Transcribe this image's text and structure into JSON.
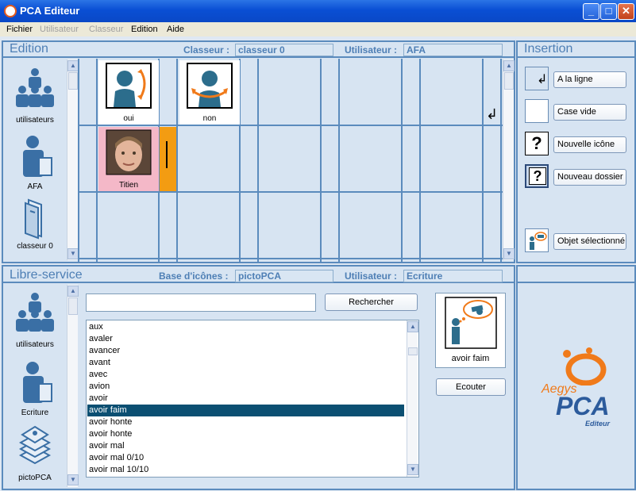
{
  "window": {
    "title": "PCA Editeur",
    "minimize": "_",
    "maximize": "□",
    "close": "✕"
  },
  "menu": [
    {
      "label": "Fichier",
      "enabled": true
    },
    {
      "label": "Utilisateur",
      "enabled": false
    },
    {
      "label": "Classeur",
      "enabled": false
    },
    {
      "label": "Edition",
      "enabled": true
    },
    {
      "label": "Aide",
      "enabled": true
    }
  ],
  "edition": {
    "title": "Edition",
    "classeur_label": "Classeur  :",
    "classeur_value": "classeur 0",
    "utilisateur_label": "Utilisateur :",
    "utilisateur_value": "AFA",
    "sidebar": [
      {
        "label": "utilisateurs",
        "icon": "users-group-icon"
      },
      {
        "label": "AFA",
        "icon": "user-folder-icon"
      },
      {
        "label": "classeur 0",
        "icon": "binder-icon"
      }
    ],
    "cells": [
      {
        "label": "oui",
        "icon": "nod-yes-pictogram"
      },
      {
        "label": "non",
        "icon": "shake-no-pictogram"
      },
      {
        "label": "Titien",
        "icon": "photo-titien"
      }
    ],
    "newline_symbol": "↲"
  },
  "insertion": {
    "title": "Insertion",
    "buttons": [
      {
        "label": "A la ligne",
        "icon": "newline-icon"
      },
      {
        "label": "Case vide",
        "icon": "empty-cell-icon"
      },
      {
        "label": "Nouvelle icône",
        "icon": "question-mark-icon"
      },
      {
        "label": "Nouveau dossier",
        "icon": "question-folder-icon"
      },
      {
        "label": "Objet sélectionné",
        "icon": "selected-object-icon"
      }
    ]
  },
  "libre": {
    "title": "Libre-service",
    "base_label": "Base d'icônes  :",
    "base_value": "pictoPCA",
    "utilisateur_label": "Utilisateur :",
    "utilisateur_value": "Ecriture",
    "sidebar": [
      {
        "label": "utilisateurs",
        "icon": "users-group-icon"
      },
      {
        "label": "Ecriture",
        "icon": "user-folder-icon"
      },
      {
        "label": "pictoPCA",
        "icon": "picto-stack-icon"
      }
    ],
    "search_value": "",
    "search_button": "Rechercher",
    "list": [
      "aux",
      "avaler",
      "avancer",
      "avant",
      "avec",
      "avion",
      "avoir",
      "avoir faim",
      "avoir honte",
      "avoir honte",
      "avoir mal",
      "avoir mal 0/10",
      "avoir mal 10/10"
    ],
    "selected": "avoir faim",
    "preview_label": "avoir faim",
    "listen_button": "Ecouter"
  },
  "brand": {
    "aegys": "Aegys",
    "pca": "PCA",
    "editeur": "Editeur"
  },
  "colors": {
    "accent": "#4e7fb5",
    "border": "#5b8bbd",
    "selection": "#0b4f72",
    "titien_cell": "#f4b8c8",
    "cursor_cell": "#f39c12",
    "logo_orange": "#f07a1a"
  }
}
